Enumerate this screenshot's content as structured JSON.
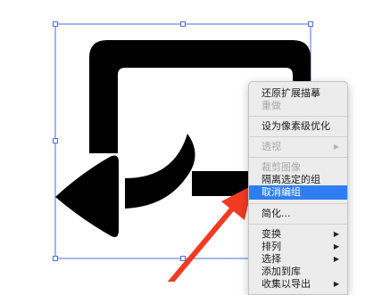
{
  "context_menu": {
    "items": [
      {
        "label": "还原扩展描摹",
        "enabled": true
      },
      {
        "label": "重做",
        "enabled": false
      },
      {
        "label": "设为像素级优化",
        "enabled": true
      },
      {
        "label": "透视",
        "enabled": false,
        "submenu": true
      },
      {
        "label": "裁剪图像",
        "enabled": false
      },
      {
        "label": "隔离选定的组",
        "enabled": true
      },
      {
        "label": "取消编组",
        "enabled": true,
        "highlighted": true
      },
      {
        "label": "简化...",
        "enabled": true
      },
      {
        "label": "变换",
        "enabled": true,
        "submenu": true
      },
      {
        "label": "排列",
        "enabled": true,
        "submenu": true
      },
      {
        "label": "选择",
        "enabled": true,
        "submenu": true
      },
      {
        "label": "添加到库",
        "enabled": true
      },
      {
        "label": "收集以导出",
        "enabled": true,
        "submenu": true
      }
    ],
    "submenu_arrow": "▶",
    "highlight_color": "#2f7ef1"
  },
  "artwork": {
    "description_icon": "return-arrow-icon",
    "fill_color": "#000000",
    "selection_color": "#4a6fd8"
  },
  "annotation": {
    "color": "#f23a22"
  }
}
